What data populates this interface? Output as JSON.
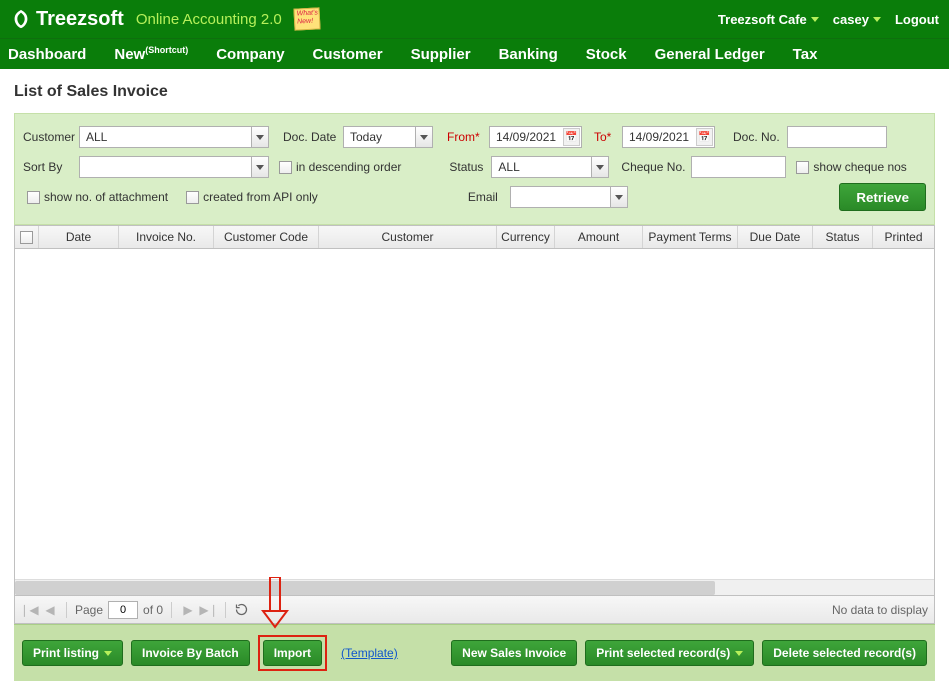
{
  "header": {
    "brand": "Treezsoft",
    "tagline": "Online Accounting 2.0",
    "sticky": "What's New!",
    "company": "Treezsoft Cafe",
    "user": "casey",
    "logout": "Logout"
  },
  "nav": {
    "dashboard": "Dashboard",
    "new": "New",
    "new_shortcut": "(Shortcut)",
    "company": "Company",
    "customer": "Customer",
    "supplier": "Supplier",
    "banking": "Banking",
    "stock": "Stock",
    "gl": "General Ledger",
    "tax": "Tax"
  },
  "page": {
    "title": "List of Sales Invoice"
  },
  "filter": {
    "customer_label": "Customer",
    "customer_value": "ALL",
    "docdate_label": "Doc. Date",
    "docdate_value": "Today",
    "from_label": "From*",
    "from_value": "14/09/2021",
    "to_label": "To*",
    "to_value": "14/09/2021",
    "docno_label": "Doc. No.",
    "docno_value": "",
    "sortby_label": "Sort By",
    "sortby_value": "",
    "desc_label": "in descending order",
    "status_label": "Status",
    "status_value": "ALL",
    "chequeno_label": "Cheque No.",
    "chequeno_value": "",
    "showcheque_label": "show cheque nos",
    "shownoattach_label": "show no. of attachment",
    "apionly_label": "created from API only",
    "email_label": "Email",
    "email_value": "",
    "retrieve": "Retrieve"
  },
  "grid": {
    "cols": {
      "date": "Date",
      "invno": "Invoice No.",
      "custcode": "Customer Code",
      "customer": "Customer",
      "currency": "Currency",
      "amount": "Amount",
      "terms": "Payment Terms",
      "duedate": "Due Date",
      "status": "Status",
      "printed": "Printed"
    }
  },
  "pager": {
    "page_label": "Page",
    "page_value": "0",
    "of_label": "of 0",
    "empty": "No data to display"
  },
  "bottom": {
    "print_listing": "Print listing",
    "invoice_batch": "Invoice By Batch",
    "import": "Import",
    "template": "(Template)",
    "new_invoice": "New Sales Invoice",
    "print_selected": "Print selected record(s)",
    "delete_selected": "Delete selected record(s)"
  }
}
